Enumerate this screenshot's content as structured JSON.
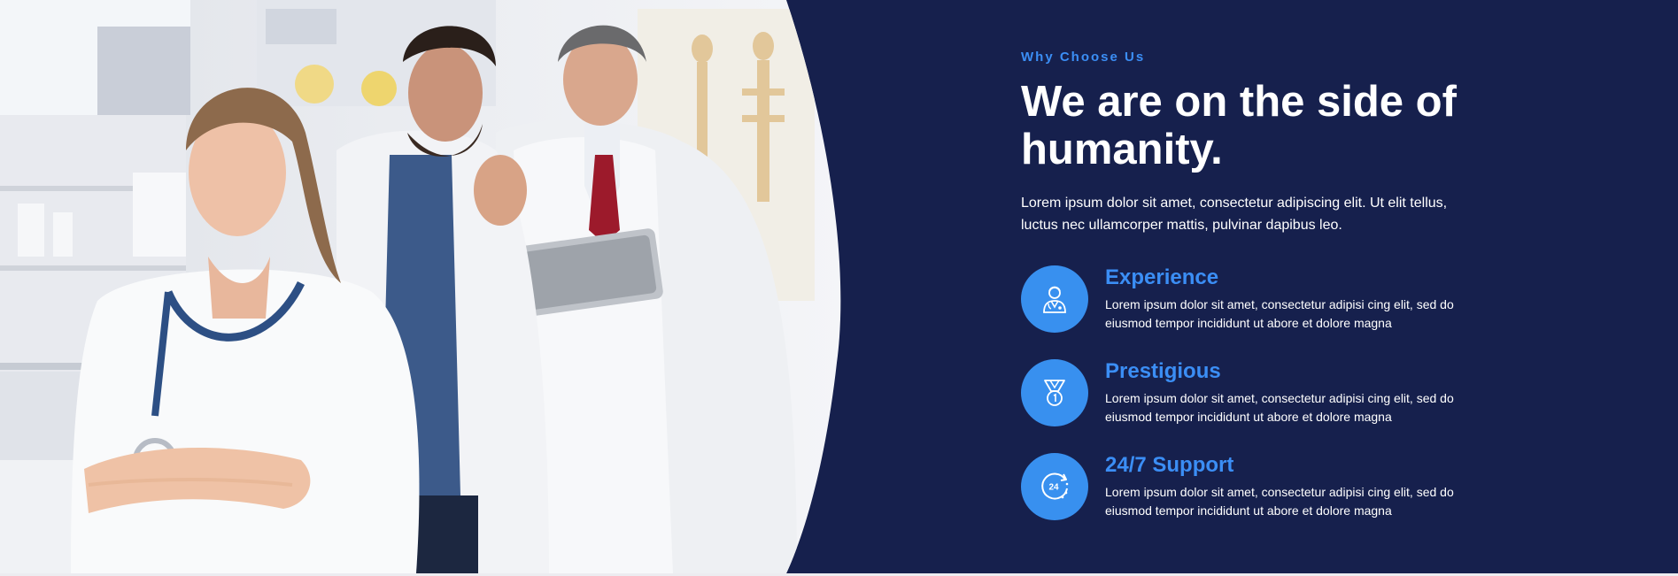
{
  "colors": {
    "panel_background": "#16204d",
    "accent": "#3890ef",
    "text": "#ffffff"
  },
  "hero_image": {
    "icon": "doctors-photo"
  },
  "section": {
    "eyebrow": "Why Choose Us",
    "heading": "We are on the side of humanity.",
    "intro": "Lorem ipsum dolor sit amet, consectetur adipiscing elit. Ut elit tellus, luctus nec ullamcorper mattis, pulvinar dapibus leo."
  },
  "features": [
    {
      "icon": "doctor-icon",
      "title": "Experience",
      "text": "Lorem ipsum dolor sit amet, consectetur adipisi cing elit, sed do eiusmod tempor incididunt ut abore et dolore magna"
    },
    {
      "icon": "medal-icon",
      "title": "Prestigious",
      "text": "Lorem ipsum dolor sit amet, consectetur adipisi cing elit, sed do eiusmod tempor incididunt ut abore et dolore magna"
    },
    {
      "icon": "support-24-icon",
      "title": "24/7 Support",
      "badge": "24",
      "text": "Lorem ipsum dolor sit amet, consectetur adipisi cing elit, sed do eiusmod tempor incididunt ut abore et dolore magna"
    }
  ]
}
